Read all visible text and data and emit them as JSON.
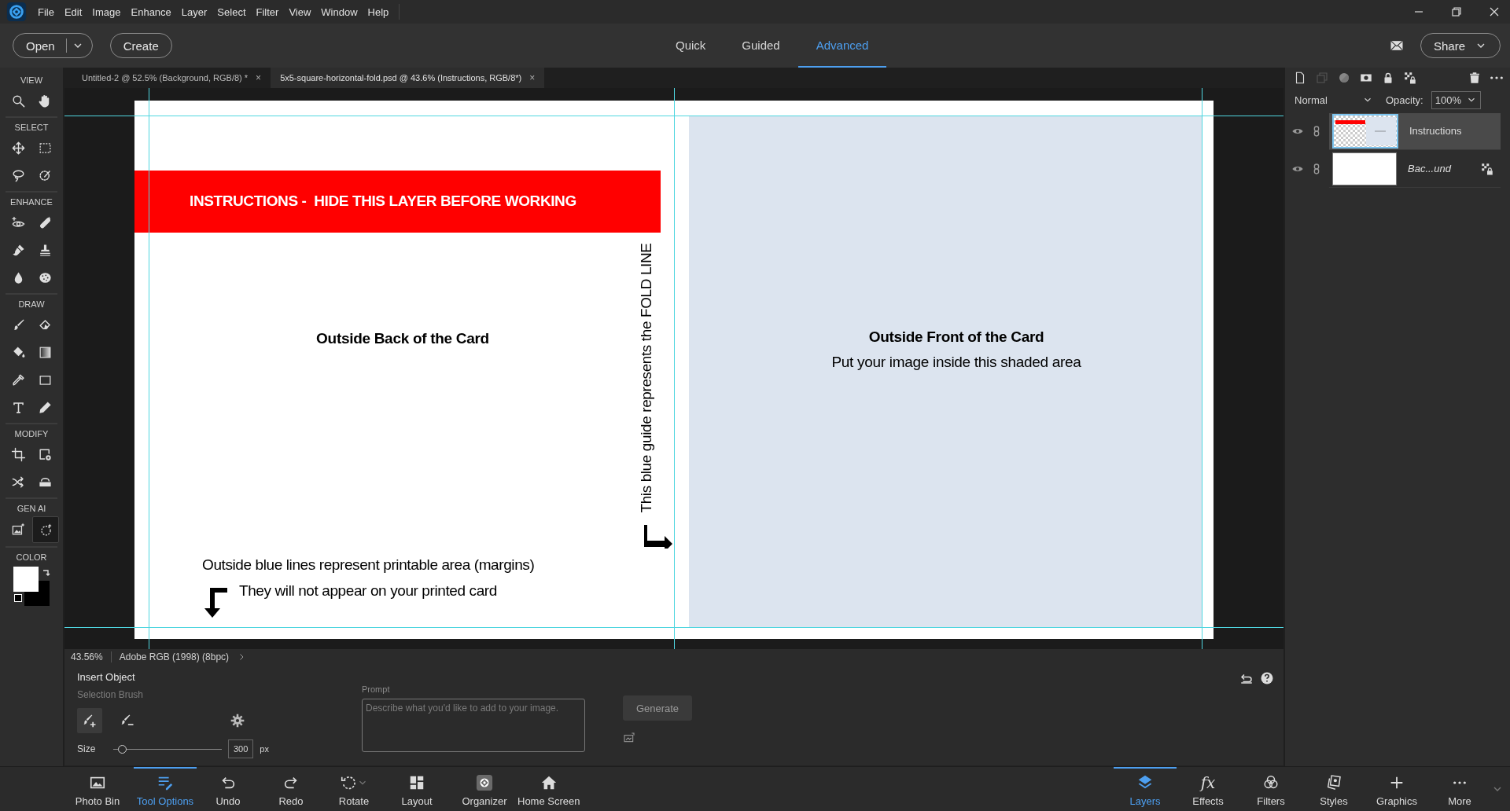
{
  "menu": [
    "File",
    "Edit",
    "Image",
    "Enhance",
    "Layer",
    "Select",
    "Filter",
    "View",
    "Window",
    "Help"
  ],
  "header": {
    "open": "Open",
    "create": "Create",
    "modes": [
      {
        "label": "Quick",
        "selected": false
      },
      {
        "label": "Guided",
        "selected": false
      },
      {
        "label": "Advanced",
        "selected": true
      }
    ],
    "share": "Share"
  },
  "doc_tabs": [
    {
      "label": "Untitled-2 @ 52.5% (Background, RGB/8) *",
      "selected": false,
      "close": "×"
    },
    {
      "label": "5x5-square-horizontal-fold.psd @ 43.6% (Instructions, RGB/8*)",
      "selected": true,
      "close": "×"
    }
  ],
  "toolbar": {
    "sections": [
      {
        "label": "VIEW",
        "tools": [
          {
            "selected": false
          },
          {
            "selected": false
          }
        ]
      },
      {
        "label": "SELECT",
        "tools": [
          {
            "selected": false
          },
          {
            "selected": false
          },
          {
            "selected": false
          },
          {
            "selected": false
          }
        ]
      },
      {
        "label": "ENHANCE",
        "tools": [
          {
            "selected": false
          },
          {
            "selected": false
          },
          {
            "selected": false
          },
          {
            "selected": false
          },
          {
            "selected": false
          },
          {
            "selected": false
          }
        ]
      },
      {
        "label": "DRAW",
        "tools": [
          {
            "selected": false
          },
          {
            "selected": false
          },
          {
            "selected": false
          },
          {
            "selected": false
          },
          {
            "selected": false
          },
          {
            "selected": false
          },
          {
            "selected": false
          },
          {
            "selected": false
          }
        ]
      },
      {
        "label": "MODIFY",
        "tools": [
          {
            "selected": false
          },
          {
            "selected": false
          },
          {
            "selected": false
          },
          {
            "selected": false
          }
        ]
      },
      {
        "label": "GEN AI",
        "tools": [
          {
            "selected": false
          },
          {
            "selected": true
          }
        ]
      },
      {
        "label": "COLOR"
      }
    ]
  },
  "document": {
    "banner": "INSTRUCTIONS -  HIDE THIS LAYER BEFORE WORKING",
    "back_label": "Outside Back of the Card",
    "front_title": "Outside Front of the Card",
    "front_subtitle": "Put your image inside this shaded area",
    "fold_note": "This blue guide represents the FOLD LINE",
    "margin_note": [
      "Outside blue lines represent printable area (margins)",
      "They will not appear on your printed card"
    ]
  },
  "layers_panel": {
    "blend_mode": "Normal",
    "opacity_label": "Opacity:",
    "opacity": "100%",
    "layers": [
      {
        "name": "Instructions",
        "selected": true,
        "locked": false
      },
      {
        "name": "Bac...und",
        "selected": false,
        "locked": true
      }
    ]
  },
  "status": {
    "zoom": "43.56%",
    "profile": "Adobe RGB (1998) (8bpc)"
  },
  "tool_options": {
    "title": "Insert Object",
    "subtitle": "Selection Brush",
    "brushes": [
      {
        "selected": true
      },
      {
        "selected": false
      }
    ],
    "size_label": "Size",
    "size": "300",
    "unit": "px",
    "level": 0.04,
    "prompt_label": "Prompt",
    "prompt_placeholder": "Describe what you'd like to add to your image.",
    "generate": "Generate"
  },
  "taskbar_left": [
    {
      "label": "Photo Bin",
      "selected": false
    },
    {
      "label": "Tool Options",
      "selected": true
    },
    {
      "label": "Undo",
      "selected": false
    },
    {
      "label": "Redo",
      "selected": false
    },
    {
      "label": "Rotate",
      "selected": false
    },
    {
      "label": "Layout",
      "selected": false
    },
    {
      "label": "Organizer",
      "selected": false
    },
    {
      "label": "Home Screen",
      "selected": false
    }
  ],
  "taskbar_right": [
    {
      "label": "Layers",
      "selected": true
    },
    {
      "label": "Effects",
      "selected": false,
      "glyph": "fx"
    },
    {
      "label": "Filters",
      "selected": false
    },
    {
      "label": "Styles",
      "selected": false
    },
    {
      "label": "Graphics",
      "selected": false
    },
    {
      "label": "More",
      "selected": false
    }
  ]
}
